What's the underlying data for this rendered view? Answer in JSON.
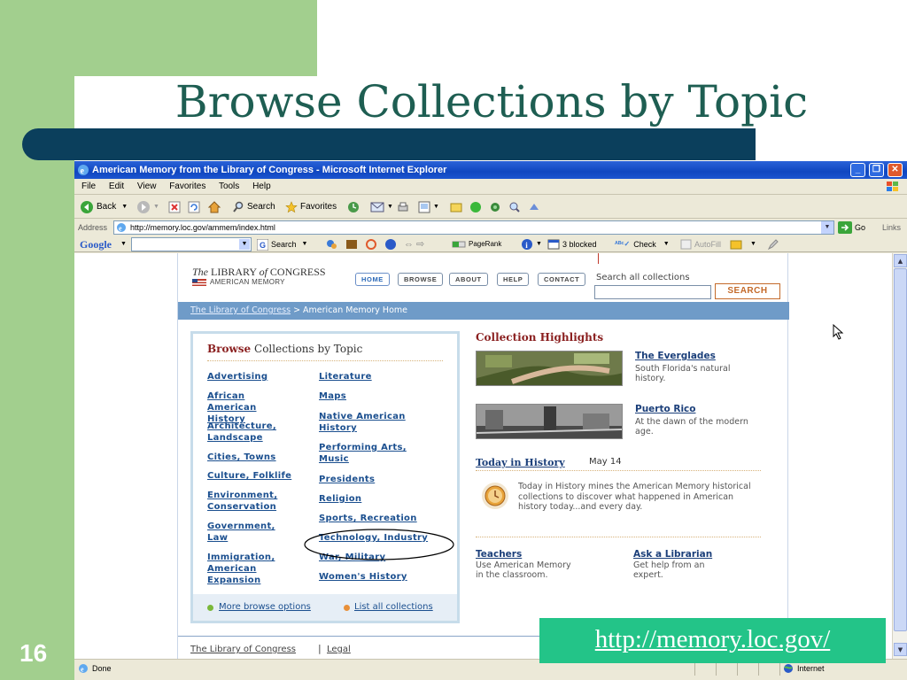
{
  "slide": {
    "title": "Browse Collections by Topic",
    "number": "16",
    "url": "http://memory.loc.gov/"
  },
  "browser": {
    "window_title": "American Memory from the Library of Congress - Microsoft Internet Explorer",
    "menu": [
      "File",
      "Edit",
      "View",
      "Favorites",
      "Tools",
      "Help"
    ],
    "toolbar": {
      "back": "Back",
      "search": "Search",
      "favorites": "Favorites"
    },
    "address": {
      "label": "Address",
      "value": "http://memory.loc.gov/ammem/index.html",
      "go": "Go",
      "links": "Links"
    },
    "google_toolbar": {
      "logo": "Google",
      "search": "Search",
      "pagerank": "PageRank",
      "blocked": "3 blocked",
      "check": "Check",
      "autofill": "AutoFill"
    },
    "status": {
      "text": "Done",
      "zone": "Internet"
    }
  },
  "page": {
    "logo": {
      "the": "The",
      "library": "LIBRARY",
      "of": "of",
      "congress": "CONGRESS",
      "sub": "AMERICAN MEMORY"
    },
    "nav": [
      "HOME",
      "BROWSE",
      "ABOUT",
      "HELP",
      "CONTACT"
    ],
    "search_label": "Search all collections",
    "search_button": "SEARCH",
    "breadcrumb": {
      "link": "The Library of Congress",
      "sep": " > ",
      "current": "American Memory Home"
    },
    "browse": {
      "title_bold": "Browse",
      "title_rest": " Collections by Topic",
      "left_topics": [
        "Advertising",
        "African American History",
        "Architecture, Landscape",
        "Cities, Towns",
        "Culture, Folklife",
        "Environment, Conservation",
        "Government, Law",
        "Immigration, American Expansion"
      ],
      "right_topics": [
        "Literature",
        "Maps",
        "Native American History",
        "Performing Arts, Music",
        "Presidents",
        "Religion",
        "Sports, Recreation",
        "Technology, Industry",
        "War, Military",
        "Women's History"
      ],
      "more_options": "More browse options",
      "list_all": "List all collections"
    },
    "highlights": {
      "title": "Collection Highlights",
      "items": [
        {
          "title": "The Everglades",
          "desc": "South Florida's natural history."
        },
        {
          "title": "Puerto Rico",
          "desc": "At the dawn of the modern age."
        }
      ],
      "today": {
        "link": "Today in History",
        "date": "May 14",
        "desc": "Today in History mines the American Memory historical collections to discover what happened in American history today...and every day."
      },
      "teachers": {
        "title": "Teachers",
        "desc": "Use American Memory in the classroom."
      },
      "librarian": {
        "title": "Ask a Librarian",
        "desc": "Get help from an expert."
      }
    },
    "footer": {
      "lc": "The Library of Congress",
      "sep": "|",
      "legal": "Legal"
    }
  },
  "colors": {
    "slide_green": "#a2cf8e",
    "title_teal": "#1e5e52",
    "bar_navy": "#0b3f5c",
    "callout_green": "#23c488",
    "link_blue": "#1b4f8f",
    "heading_red": "#8a1f1f"
  },
  "icons": [
    "ie-icon",
    "back-arrow-icon",
    "forward-arrow-icon",
    "stop-icon",
    "refresh-icon",
    "home-icon",
    "search-icon",
    "favorites-star-icon",
    "history-icon",
    "mail-icon",
    "print-icon",
    "go-arrow-icon",
    "page-icon",
    "clock-icon",
    "flag-icon",
    "cursor-icon",
    "globe-icon"
  ]
}
